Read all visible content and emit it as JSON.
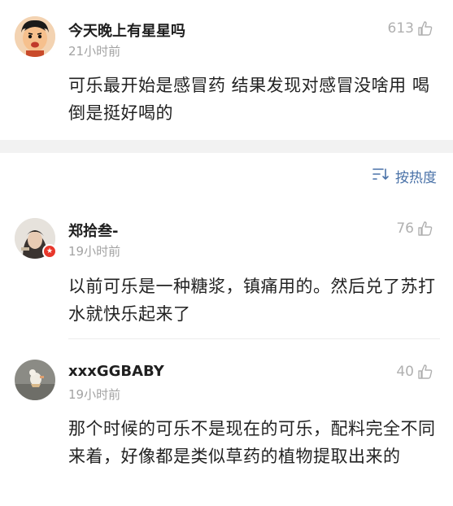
{
  "top_comment": {
    "username": "今天晚上有星星吗",
    "time": "21小时前",
    "likes": "613",
    "text": "可乐最开始是感冒药 结果发现对感冒没啥用 喝倒是挺好喝的"
  },
  "sort": {
    "label": "按热度",
    "icon": "sort-icon"
  },
  "comments": [
    {
      "username": "郑拾叁-",
      "time": "19小时前",
      "likes": "76",
      "text": "以前可乐是一种糖浆，镇痛用的。然后兑了苏打水就快乐起来了",
      "badge": "weibo-verified-badge"
    },
    {
      "username": "xxxGGBABY",
      "time": "19小时前",
      "likes": "40",
      "text": "那个时候的可乐不是现在的可乐，配料完全不同来着，好像都是类似草药的植物提取出来的"
    }
  ],
  "colors": {
    "accent": "#4a72a8",
    "badge": "#e8372b",
    "muted": "#a3a3a3"
  }
}
